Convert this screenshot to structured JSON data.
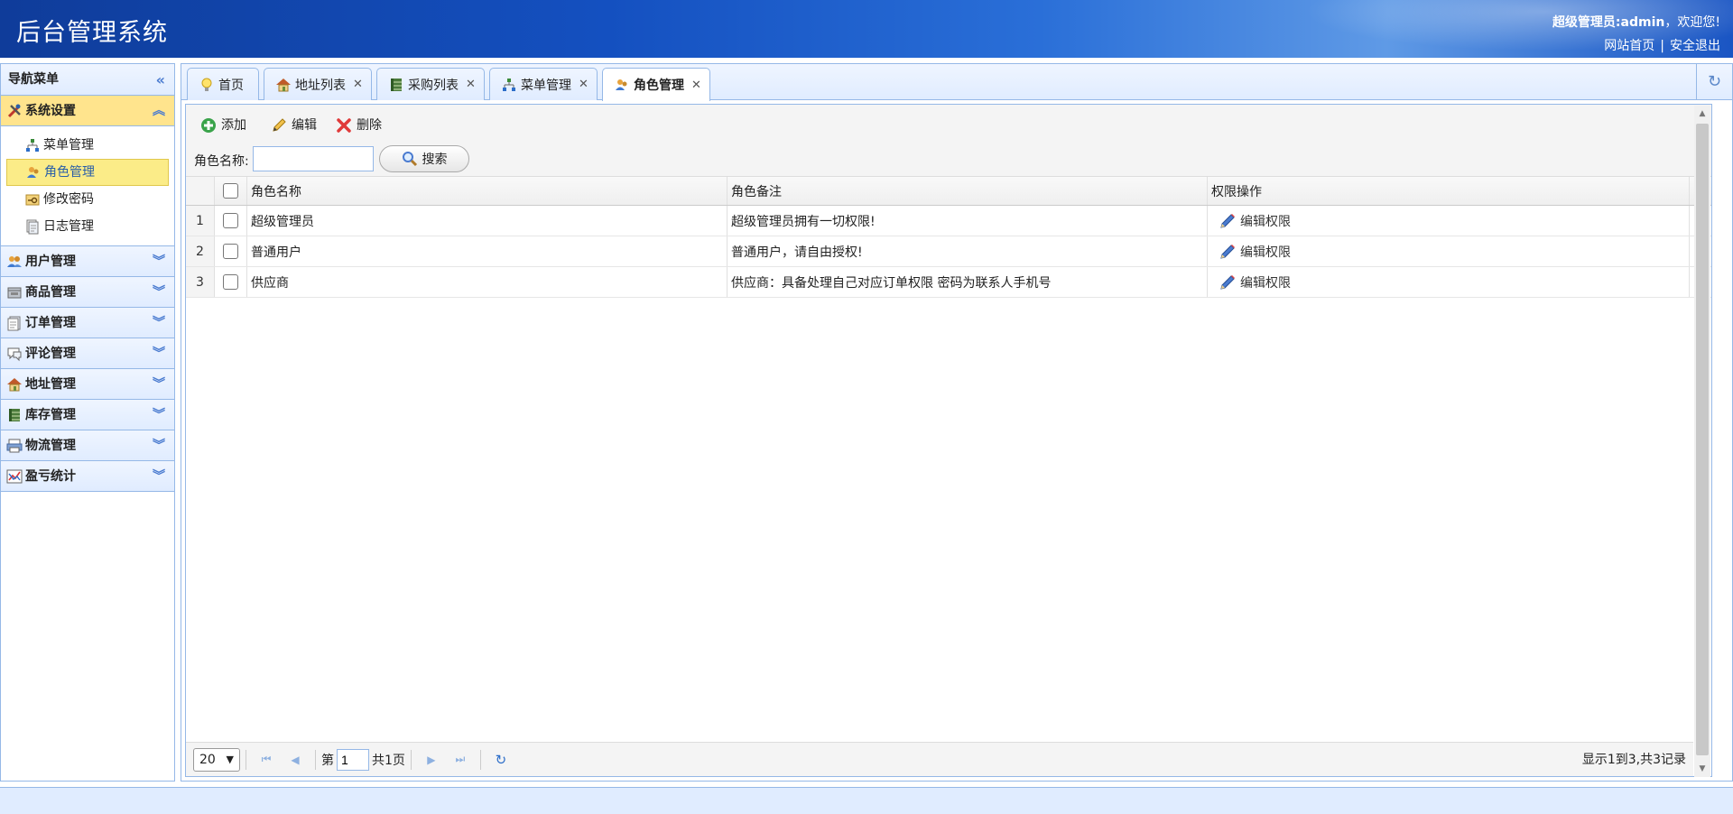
{
  "header": {
    "title": "后台管理系统",
    "welcome_role": "超级管理员:",
    "welcome_user": "admin",
    "welcome_suffix": "，欢迎您!",
    "link_home": "网站首页",
    "link_sep": "|",
    "link_logout": "安全退出"
  },
  "sidebar": {
    "title": "导航菜单",
    "active_group": {
      "label": "系统设置",
      "items": [
        {
          "label": "菜单管理",
          "icon": "sitemap-icon"
        },
        {
          "label": "角色管理",
          "icon": "users-role-icon"
        },
        {
          "label": "修改密码",
          "icon": "password-icon"
        },
        {
          "label": "日志管理",
          "icon": "log-icon"
        }
      ]
    },
    "groups": [
      {
        "label": "用户管理",
        "icon": "user-icon"
      },
      {
        "label": "商品管理",
        "icon": "goods-icon"
      },
      {
        "label": "订单管理",
        "icon": "order-icon"
      },
      {
        "label": "评论管理",
        "icon": "comment-icon"
      },
      {
        "label": "地址管理",
        "icon": "address-icon"
      },
      {
        "label": "库存管理",
        "icon": "stock-icon"
      },
      {
        "label": "物流管理",
        "icon": "logistics-icon"
      },
      {
        "label": "盈亏统计",
        "icon": "chart-icon"
      }
    ]
  },
  "tabs": [
    {
      "label": "首页"
    },
    {
      "label": "地址列表"
    },
    {
      "label": "采购列表"
    },
    {
      "label": "菜单管理"
    },
    {
      "label": "角色管理"
    }
  ],
  "toolbar": {
    "add": "添加",
    "edit": "编辑",
    "delete": "删除",
    "search_label": "角色名称:",
    "search_value": "",
    "search_button": "搜索"
  },
  "grid": {
    "columns": [
      "角色名称",
      "角色备注",
      "权限操作"
    ],
    "rows": [
      {
        "num": "1",
        "name": "超级管理员",
        "note": "超级管理员拥有一切权限!",
        "op": "编辑权限"
      },
      {
        "num": "2",
        "name": "普通用户",
        "note": "普通用户，请自由授权!",
        "op": "编辑权限"
      },
      {
        "num": "3",
        "name": "供应商",
        "note": "供应商：具备处理自己对应订单权限 密码为联系人手机号",
        "op": "编辑权限"
      }
    ]
  },
  "pager": {
    "page_size": "20",
    "page_prefix": "第",
    "current_page": "1",
    "total_pages": "共1页",
    "info": "显示1到3,共3记录"
  },
  "colors": {
    "header_blue": "#1450c0",
    "panel_border": "#95b8e7",
    "active_yellow": "#ffe48d"
  }
}
